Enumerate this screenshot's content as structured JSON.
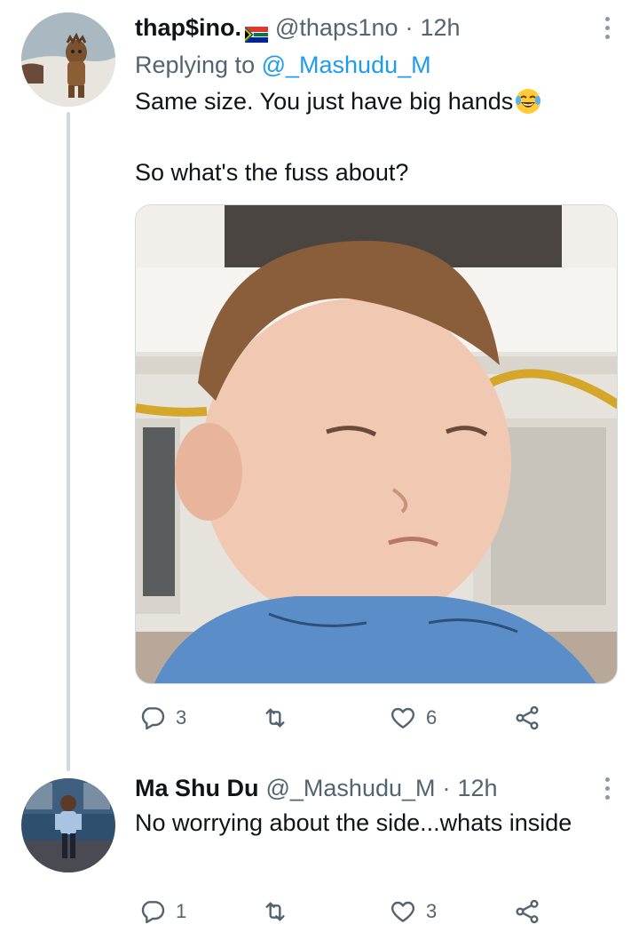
{
  "tweets": [
    {
      "author_name": "thap$ino.",
      "author_flag": "south-africa-flag-icon",
      "handle": "@thaps1no",
      "separator": "·",
      "time": "12h",
      "reply_prefix": "Replying to",
      "reply_mention": "@_Mashudu_M",
      "text_line1": "Same size. You just have big hands",
      "text_line1_emoji": "laughing-tears-emoji",
      "text_line2": "So what's the fuss about?",
      "media": "baby-side-eye-photo",
      "stats": {
        "replies": "3",
        "retweets": "",
        "likes": "6"
      }
    },
    {
      "author_name": "Ma Shu Du",
      "handle": "@_Mashudu_M",
      "separator": "·",
      "time": "12h",
      "text": "No worrying about the side...whats inside",
      "stats": {
        "replies": "1",
        "retweets": "",
        "likes": "3"
      }
    }
  ],
  "colors": {
    "text": "#0f1419",
    "secondary": "#536471",
    "link": "#1d9bf0",
    "line": "#cfd9de"
  }
}
